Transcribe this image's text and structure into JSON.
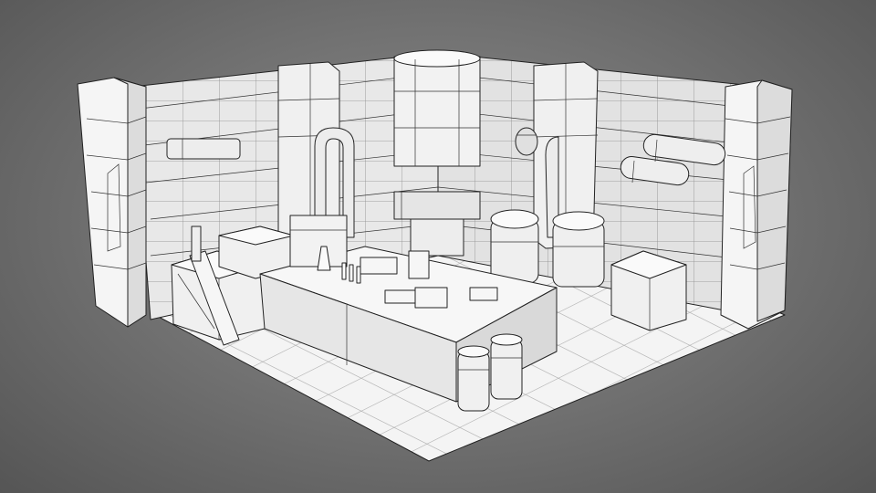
{
  "scene": {
    "kind": "isometric-wireframe-render",
    "subject": "sci-fi lab room",
    "palette": {
      "background": "#6f6f6f",
      "surface": "#f2f2f2",
      "shade": "#d6d6d6",
      "wire": "#333333"
    }
  }
}
